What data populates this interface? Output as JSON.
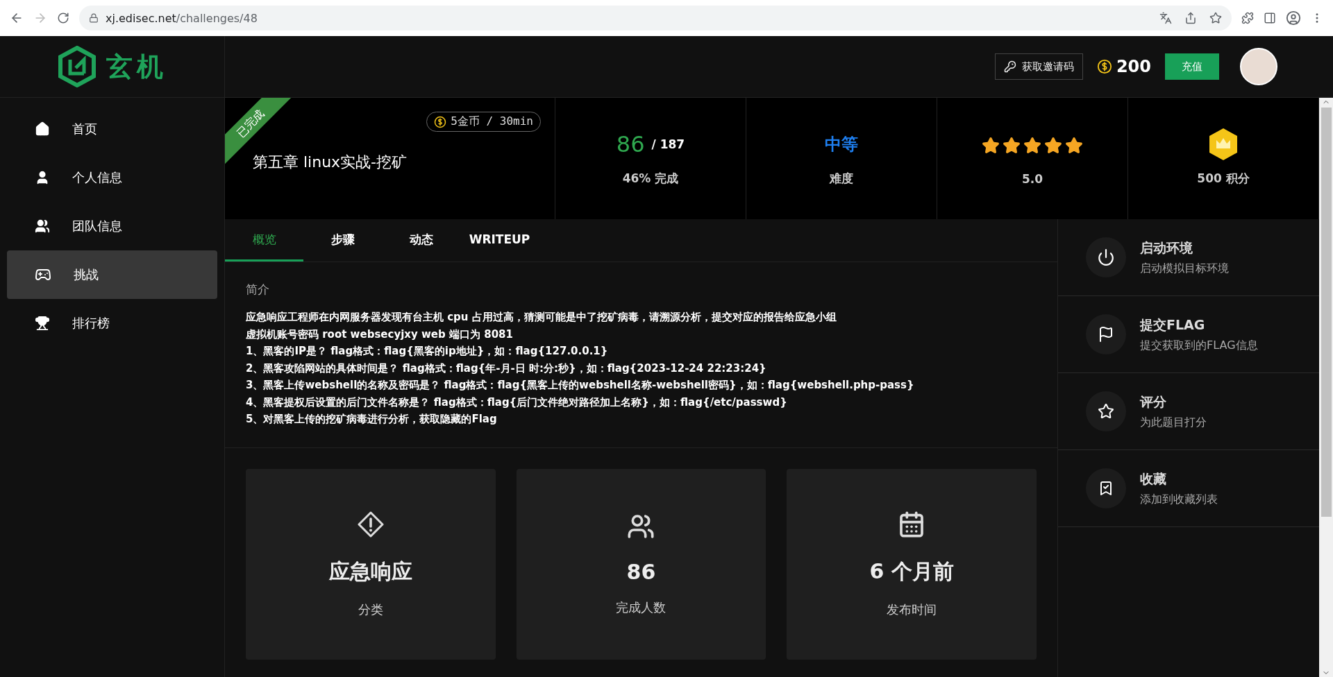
{
  "browser": {
    "url_host": "xj.edisec.net",
    "url_path": "/challenges/48"
  },
  "header": {
    "logo": "玄机",
    "invite_button": "获取邀请码",
    "coins": "200",
    "recharge_button": "充值"
  },
  "sidebar": {
    "items": [
      {
        "kind": "home",
        "label": "首页",
        "selected": false
      },
      {
        "kind": "user",
        "label": "个人信息",
        "selected": false
      },
      {
        "kind": "team",
        "label": "团队信息",
        "selected": false
      },
      {
        "kind": "game",
        "label": "挑战",
        "selected": true
      },
      {
        "kind": "trophy",
        "label": "排行榜",
        "selected": false
      }
    ]
  },
  "challenge": {
    "completed": true,
    "ribbon": "已完成",
    "title": "第五章 linux实战-挖矿",
    "cost": "5金币 / 30min"
  },
  "stats": {
    "solved": "86",
    "total": "/ 187",
    "progress": "46% 完成",
    "difficulty": "中等",
    "difficulty_label": "难度",
    "stars": 5,
    "rating": "5.0",
    "points": "500 积分"
  },
  "tabs": [
    {
      "label": "概览",
      "selected": true
    },
    {
      "label": "步骤",
      "selected": false
    },
    {
      "label": "动态",
      "selected": false
    },
    {
      "label": "WRITEUP",
      "selected": false
    }
  ],
  "intro": {
    "heading": "简介",
    "lines": [
      "应急响应工程师在内网服务器发现有台主机 cpu 占用过高，猜测可能是中了挖矿病毒，请溯源分析，提交对应的报告给应急小组",
      "虚拟机账号密码 root websecyjxy web 端口为 8081",
      "1、黑客的IP是？ flag格式：flag{黑客的ip地址}，如：flag{127.0.0.1}",
      "2、黑客攻陷网站的具体时间是？ flag格式：flag{年-月-日 时:分:秒}，如：flag{2023-12-24 22:23:24}",
      "3、黑客上传webshell的名称及密码是？ flag格式：flag{黑客上传的webshell名称-webshell密码}，如：flag{webshell.php-pass}",
      "4、黑客提权后设置的后门文件名称是？ flag格式：flag{后门文件绝对路径加上名称}，如：flag{/etc/passwd}",
      "5、对黑客上传的挖矿病毒进行分析，获取隐藏的Flag"
    ]
  },
  "cards": [
    {
      "kind": "category",
      "value": "应急响应",
      "label": "分类"
    },
    {
      "kind": "solvers",
      "value": "86",
      "label": "完成人数"
    },
    {
      "kind": "published",
      "value": "6 个月前",
      "label": "发布时间"
    }
  ],
  "actions": [
    {
      "kind": "start",
      "title": "启动环境",
      "subtitle": "启动模拟目标环境"
    },
    {
      "kind": "flag",
      "title": "提交FLAG",
      "subtitle": "提交获取到的FLAG信息"
    },
    {
      "kind": "rate",
      "title": "评分",
      "subtitle": "为此题目打分"
    },
    {
      "kind": "favorite",
      "title": "收藏",
      "subtitle": "添加到收藏列表"
    }
  ]
}
